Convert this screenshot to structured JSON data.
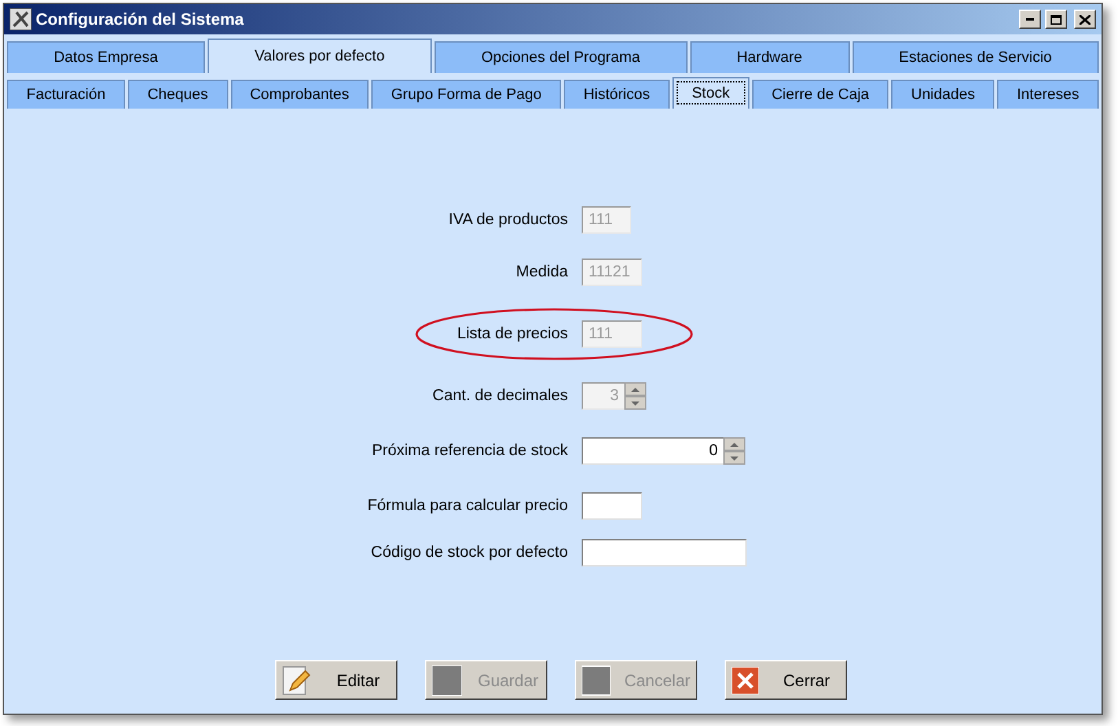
{
  "window": {
    "title": "Configuración del Sistema"
  },
  "tabs": [
    {
      "label": "Datos Empresa",
      "selected": false
    },
    {
      "label": "Valores por defecto",
      "selected": true
    },
    {
      "label": "Opciones del Programa",
      "selected": false
    },
    {
      "label": "Hardware",
      "selected": false
    },
    {
      "label": "Estaciones de Servicio",
      "selected": false
    }
  ],
  "subtabs": [
    {
      "label": "Facturación",
      "selected": false
    },
    {
      "label": "Cheques",
      "selected": false
    },
    {
      "label": "Comprobantes",
      "selected": false
    },
    {
      "label": "Grupo Forma de Pago",
      "selected": false
    },
    {
      "label": "Históricos",
      "selected": false
    },
    {
      "label": "Stock",
      "selected": true
    },
    {
      "label": "Cierre de Caja",
      "selected": false
    },
    {
      "label": "Unidades",
      "selected": false
    },
    {
      "label": "Intereses",
      "selected": false
    }
  ],
  "fields": [
    {
      "label": "IVA de productos",
      "kind": "text",
      "value": "111",
      "disabled": true,
      "highlighted": false
    },
    {
      "label": "Medida",
      "kind": "text",
      "value": "11121",
      "disabled": true,
      "highlighted": false
    },
    {
      "label": "Lista de precios",
      "kind": "text",
      "value": "111",
      "disabled": true,
      "highlighted": true
    },
    {
      "label": "Cant. de decimales",
      "kind": "spinner",
      "value": "3",
      "disabled": true,
      "highlighted": false
    },
    {
      "label": "Próxima referencia de stock",
      "kind": "spinner",
      "value": "0",
      "disabled": false,
      "highlighted": false
    },
    {
      "label": "Fórmula para calcular precio",
      "kind": "text",
      "disabled": false,
      "highlighted": false
    },
    {
      "label": "Código de stock por defecto",
      "kind": "text",
      "disabled": false,
      "highlighted": false
    }
  ],
  "buttons": [
    {
      "label": "Editar",
      "disabled": false
    },
    {
      "label": "Guardar",
      "disabled": true
    },
    {
      "label": "Cancelar",
      "disabled": true
    },
    {
      "label": "Cerrar",
      "disabled": false
    }
  ]
}
